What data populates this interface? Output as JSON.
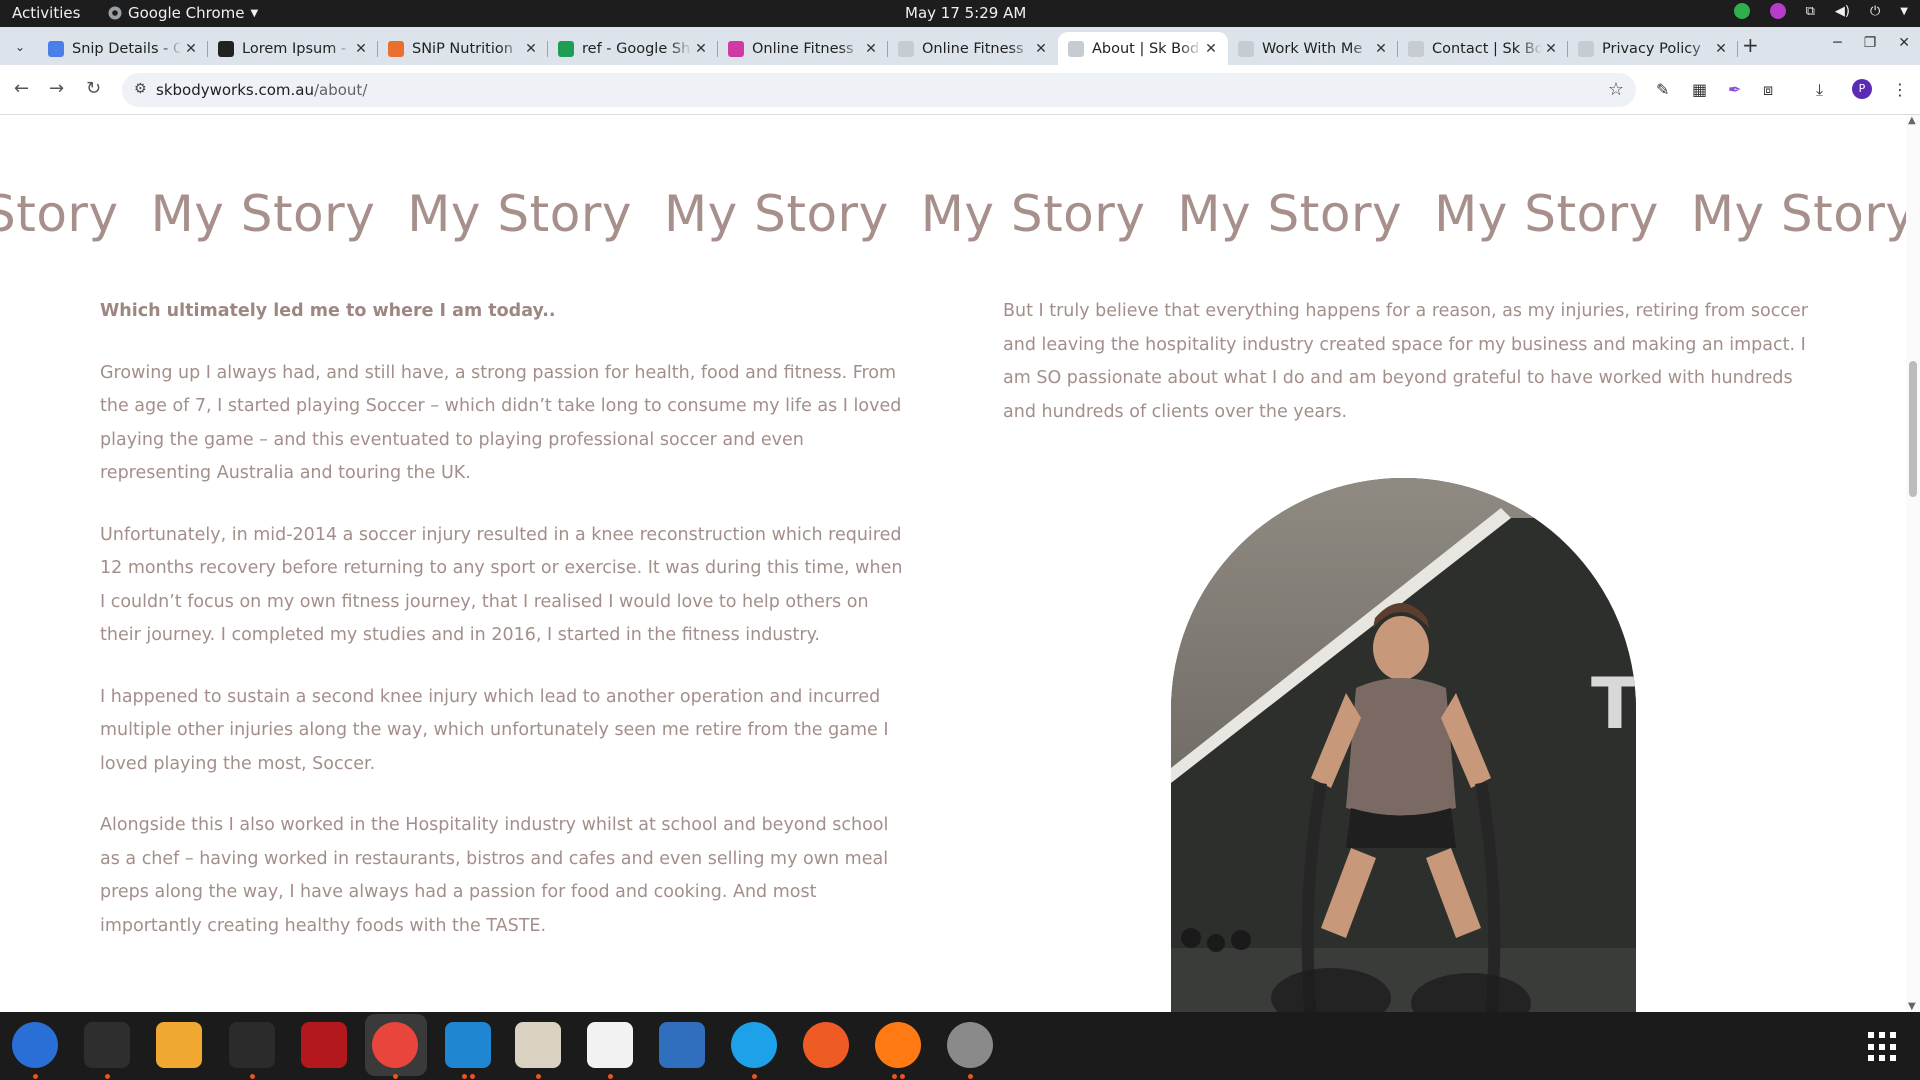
{
  "system": {
    "activities": "Activities",
    "app_name": "Google Chrome",
    "clock": "May 17  5:29 AM"
  },
  "browser": {
    "tabs": [
      {
        "title": "Snip Details - C",
        "favicon": "docs-icon",
        "color": "#4a7ee8"
      },
      {
        "title": "Lorem Ipsum -",
        "favicon": "lipsum-icon",
        "color": "#222222"
      },
      {
        "title": "SNiP Nutrition",
        "favicon": "snip-icon",
        "color": "#e86f2d"
      },
      {
        "title": "ref - Google Sh",
        "favicon": "sheets-icon",
        "color": "#1e9d55"
      },
      {
        "title": "Online Fitness",
        "favicon": "fitness-icon",
        "color": "#d23aa3"
      },
      {
        "title": "Online Fitness",
        "favicon": "site-icon",
        "color": "#c7ccd2"
      },
      {
        "title": "About | Sk Bod",
        "favicon": "site-icon",
        "color": "#c7ccd2"
      },
      {
        "title": "Work With Me",
        "favicon": "site-icon",
        "color": "#c7ccd2"
      },
      {
        "title": "Contact | Sk Bo",
        "favicon": "site-icon",
        "color": "#c7ccd2"
      },
      {
        "title": "Privacy Policy",
        "favicon": "site-icon",
        "color": "#c7ccd2"
      }
    ],
    "active_tab_index": 6,
    "url_domain": "skbodyworks.com.au",
    "url_path": "/about/"
  },
  "page": {
    "marquee_text": "My Story",
    "marquee_head": "Story",
    "marquee_tail": "My S",
    "left_paragraphs": [
      "Which ultimately led me to where I am today..",
      "Growing up I always had, and still have, a strong passion for health, food and fitness. From the age of 7, I started playing Soccer – which didn’t take long to consume my life as I loved playing the game – and this eventuated to playing professional soccer and even representing Australia and touring the UK.",
      "Unfortunately, in mid-2014 a soccer injury resulted in a knee reconstruction which required 12 months recovery before returning to any sport or exercise. It was during this time, when I couldn’t focus on my own fitness journey, that I realised I would love to help others on their journey. I completed my studies and in 2016, I started in the fitness industry.",
      "I happened to sustain a second knee injury which lead to another operation and incurred multiple other injuries along the way, which unfortunately seen me retire from the game I loved playing the most, Soccer.",
      "Alongside this I also worked in the Hospitality industry whilst at school and beyond school as a chef – having worked in restaurants, bistros and cafes and even selling my own meal preps along the way, I have always had a passion for food and cooking. And most importantly creating healthy foods with the TASTE."
    ],
    "right_paragraph": "But I truly believe that everything happens for a reason, as my injuries, retiring from soccer and leaving the hospitality industry created space for my business and making an impact. I am SO passionate about what I do and am beyond grateful to have worked with hundreds and hundreds of clients over the years.",
    "text_color": "#a38f8a",
    "lead_color": "#9e8782"
  },
  "dock": {
    "apps": [
      {
        "name": "thunderbird-icon",
        "color": "#2a6fd6"
      },
      {
        "name": "terminal-icon",
        "color": "#2e2e2e"
      },
      {
        "name": "calculator-icon",
        "color": "#f0a830"
      },
      {
        "name": "system-monitor-icon",
        "color": "#2b2b2b"
      },
      {
        "name": "filezilla-icon",
        "color": "#b3181d"
      },
      {
        "name": "chrome-icon",
        "color": "#e8453c"
      },
      {
        "name": "vscode-icon",
        "color": "#1f86d1"
      },
      {
        "name": "files-icon",
        "color": "#d9d1c2"
      },
      {
        "name": "text-editor-icon",
        "color": "#f2f2f2"
      },
      {
        "name": "document-viewer-icon",
        "color": "#2f6fbd"
      },
      {
        "name": "skype-icon",
        "color": "#1da1e8"
      },
      {
        "name": "postman-icon",
        "color": "#ef5b25"
      },
      {
        "name": "firefox-like-icon",
        "color": "#ff7a12"
      },
      {
        "name": "disk-utility-icon",
        "color": "#8a8a8a"
      }
    ]
  }
}
